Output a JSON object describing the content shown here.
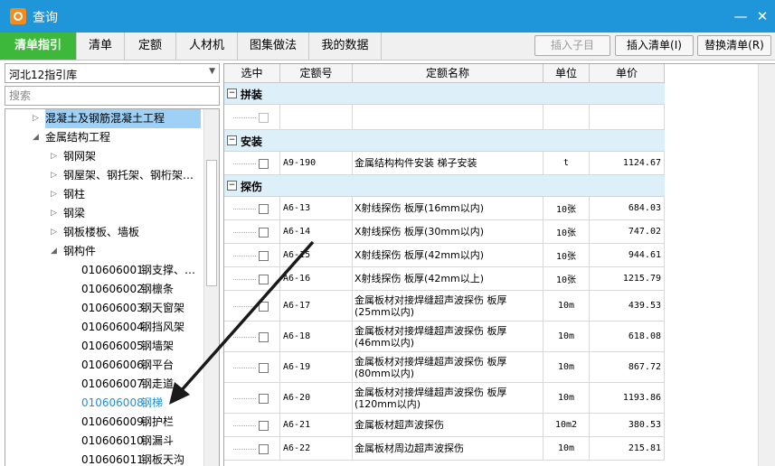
{
  "window": {
    "title": "查询",
    "minimize_icon": "minimize-icon",
    "close_icon": "close-icon",
    "minimize_glyph": "—",
    "close_glyph": "✕"
  },
  "tabs": [
    {
      "label": "清单指引",
      "active": true
    },
    {
      "label": "清单"
    },
    {
      "label": "定额"
    },
    {
      "label": "人材机"
    },
    {
      "label": "图集做法"
    },
    {
      "label": "我的数据"
    }
  ],
  "toolbar": {
    "insert_child": "插入子目",
    "insert_list": "插入清单(I)",
    "replace_list": "替换清单(R)"
  },
  "left": {
    "library": "河北12指引库",
    "search_placeholder": "搜索",
    "tree": [
      {
        "arrow": "▷",
        "name": "混凝土及钢筋混凝土工程",
        "level": 1
      },
      {
        "arrow": "◢",
        "name": "金属结构工程",
        "level": 1
      },
      {
        "arrow": "▷",
        "name": "钢网架",
        "level": 2
      },
      {
        "arrow": "▷",
        "name": "钢屋架、钢托架、钢桁架…",
        "level": 2
      },
      {
        "arrow": "▷",
        "name": "钢柱",
        "level": 2
      },
      {
        "arrow": "▷",
        "name": "钢梁",
        "level": 2
      },
      {
        "arrow": "▷",
        "name": "钢板楼板、墙板",
        "level": 2
      },
      {
        "arrow": "◢",
        "name": "钢构件",
        "level": 2
      },
      {
        "code": "010606001",
        "name": "钢支撑、…"
      },
      {
        "code": "010606002",
        "name": "钢檩条"
      },
      {
        "code": "010606003",
        "name": "钢天窗架"
      },
      {
        "code": "010606004",
        "name": "钢挡风架"
      },
      {
        "code": "010606005",
        "name": "钢墙架"
      },
      {
        "code": "010606006",
        "name": "钢平台"
      },
      {
        "code": "010606007",
        "name": "钢走道"
      },
      {
        "code": "010606008",
        "name": "钢梯",
        "selected": true
      },
      {
        "code": "010606009",
        "name": "钢护栏"
      },
      {
        "code": "010606010",
        "name": "钢漏斗"
      },
      {
        "code": "010606011",
        "name": "钢板天沟"
      }
    ]
  },
  "table": {
    "headers": {
      "select": "选中",
      "code": "定额号",
      "name": "定额名称",
      "unit": "单位",
      "price": "单价"
    },
    "groups": [
      {
        "title": "拼装",
        "toggle": "−",
        "rows": [
          {
            "code": "",
            "name": "",
            "unit": "",
            "price": "",
            "empty": true
          }
        ]
      },
      {
        "title": "安装",
        "toggle": "−",
        "rows": [
          {
            "code": "A9-190",
            "name": "金属结构构件安装 梯子安装",
            "unit": "t",
            "price": "1124.67"
          }
        ]
      },
      {
        "title": "探伤",
        "toggle": "−",
        "rows": [
          {
            "code": "A6-13",
            "name": "X射线探伤 板厚(16mm以内)",
            "unit": "10张",
            "price": "684.03"
          },
          {
            "code": "A6-14",
            "name": "X射线探伤 板厚(30mm以内)",
            "unit": "10张",
            "price": "747.02"
          },
          {
            "code": "A6-15",
            "name": "X射线探伤 板厚(42mm以内)",
            "unit": "10张",
            "price": "944.61"
          },
          {
            "code": "A6-16",
            "name": "X射线探伤 板厚(42mm以上)",
            "unit": "10张",
            "price": "1215.79"
          },
          {
            "code": "A6-17",
            "name": "金属板材对接焊缝超声波探伤 板厚(25mm以内)",
            "unit": "10m",
            "price": "439.53",
            "tall": true
          },
          {
            "code": "A6-18",
            "name": "金属板材对接焊缝超声波探伤 板厚(46mm以内)",
            "unit": "10m",
            "price": "618.08",
            "tall": true
          },
          {
            "code": "A6-19",
            "name": "金属板材对接焊缝超声波探伤 板厚(80mm以内)",
            "unit": "10m",
            "price": "867.72",
            "tall": true
          },
          {
            "code": "A6-20",
            "name": "金属板材对接焊缝超声波探伤 板厚(120mm以内)",
            "unit": "10m",
            "price": "1193.86",
            "tall": true
          },
          {
            "code": "A6-21",
            "name": "金属板材超声波探伤",
            "unit": "10m2",
            "price": "380.53"
          },
          {
            "code": "A6-22",
            "name": "金属板材周边超声波探伤",
            "unit": "10m",
            "price": "215.81"
          }
        ]
      }
    ]
  },
  "colors": {
    "titlebar": "#1f96d9",
    "active_tab": "#3db83b",
    "group_row": "#ddeff8",
    "selected_item": "#1e90d8",
    "arrow": "#1a1a1a"
  }
}
